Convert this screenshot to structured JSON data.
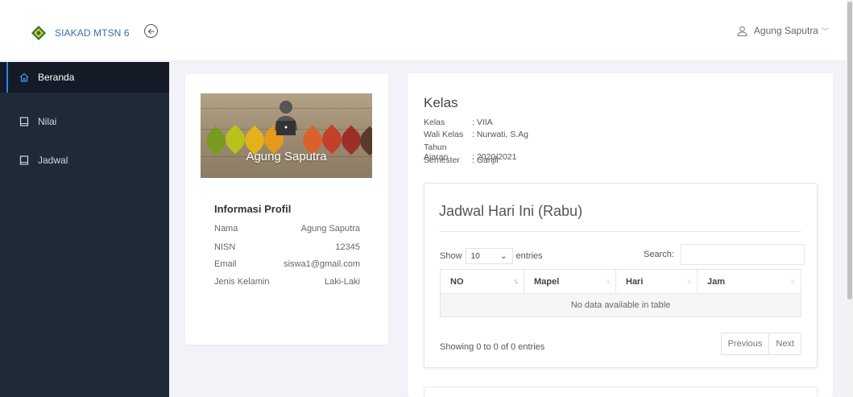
{
  "app": {
    "brand": "SIAKAD MTSN 6",
    "brand_color": "#3a6fb0"
  },
  "user": {
    "name": "Agung Saputra"
  },
  "sidebar": {
    "items": [
      {
        "label": "Beranda",
        "icon": "home-icon",
        "active": true
      },
      {
        "label": "Nilai",
        "icon": "book-icon",
        "active": false
      },
      {
        "label": "Jadwal",
        "icon": "book-icon",
        "active": false
      }
    ]
  },
  "profile": {
    "banner_name": "Agung Saputra",
    "section_title": "Informasi Profil",
    "fields": [
      {
        "label": "Nama",
        "value": "Agung Saputra"
      },
      {
        "label": "NISN",
        "value": "12345"
      },
      {
        "label": "Email",
        "value": "siswa1@gmail.com"
      },
      {
        "label": "Jenis Kelamin",
        "value": "Laki-Laki"
      }
    ]
  },
  "kelas": {
    "title": "Kelas",
    "rows": [
      {
        "label": "Kelas",
        "value": ": VIIA"
      },
      {
        "label": "Wali Kelas",
        "value": ": Nurwati, S.Ag"
      },
      {
        "label": "Tahun Ajaran",
        "value": ": 2020/2021"
      },
      {
        "label": "Semester",
        "value": ": Ganjil"
      }
    ]
  },
  "jadwal": {
    "title": "Jadwal Hari Ini (Rabu)",
    "show_label": "Show",
    "entries_value": "10",
    "entries_label": "entries",
    "search_label": "Search:",
    "search_value": "",
    "columns": [
      "NO",
      "Mapel",
      "Hari",
      "Jam"
    ],
    "empty_text": "No data available in table",
    "info": "Showing 0 to 0 of 0 entries",
    "prev_label": "Previous",
    "next_label": "Next"
  }
}
